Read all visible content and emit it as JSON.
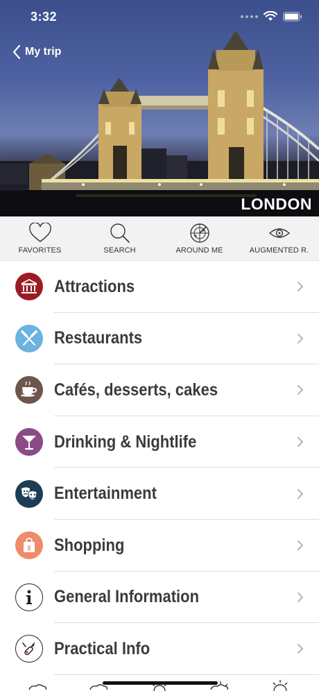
{
  "status_bar": {
    "time": "3:32"
  },
  "header": {
    "back_label": "My trip",
    "city": "LONDON"
  },
  "quick_actions": [
    {
      "label": "FAVORITES",
      "icon": "heart-icon"
    },
    {
      "label": "SEARCH",
      "icon": "magnifier-icon"
    },
    {
      "label": "AROUND ME",
      "icon": "radar-icon"
    },
    {
      "label": "AUGMENTED R.",
      "icon": "eye-icon"
    }
  ],
  "categories": [
    {
      "label": "Attractions",
      "icon": "museum-icon",
      "color": "#9b1b24"
    },
    {
      "label": "Restaurants",
      "icon": "fork-knife-icon",
      "color": "#6bb3e0"
    },
    {
      "label": "Cafés, desserts, cakes",
      "icon": "coffee-cup-icon",
      "color": "#6e564c"
    },
    {
      "label": "Drinking & Nightlife",
      "icon": "cocktail-icon",
      "color": "#8a4a86"
    },
    {
      "label": "Entertainment",
      "icon": "theater-masks-icon",
      "color": "#1c3d54"
    },
    {
      "label": "Shopping",
      "icon": "shopping-bag-icon",
      "color": "#ef8a6b"
    },
    {
      "label": "General Information",
      "icon": "info-icon",
      "color": "#ffffff"
    },
    {
      "label": "Practical Info",
      "icon": "pocket-knife-icon",
      "color": "#ffffff"
    }
  ]
}
